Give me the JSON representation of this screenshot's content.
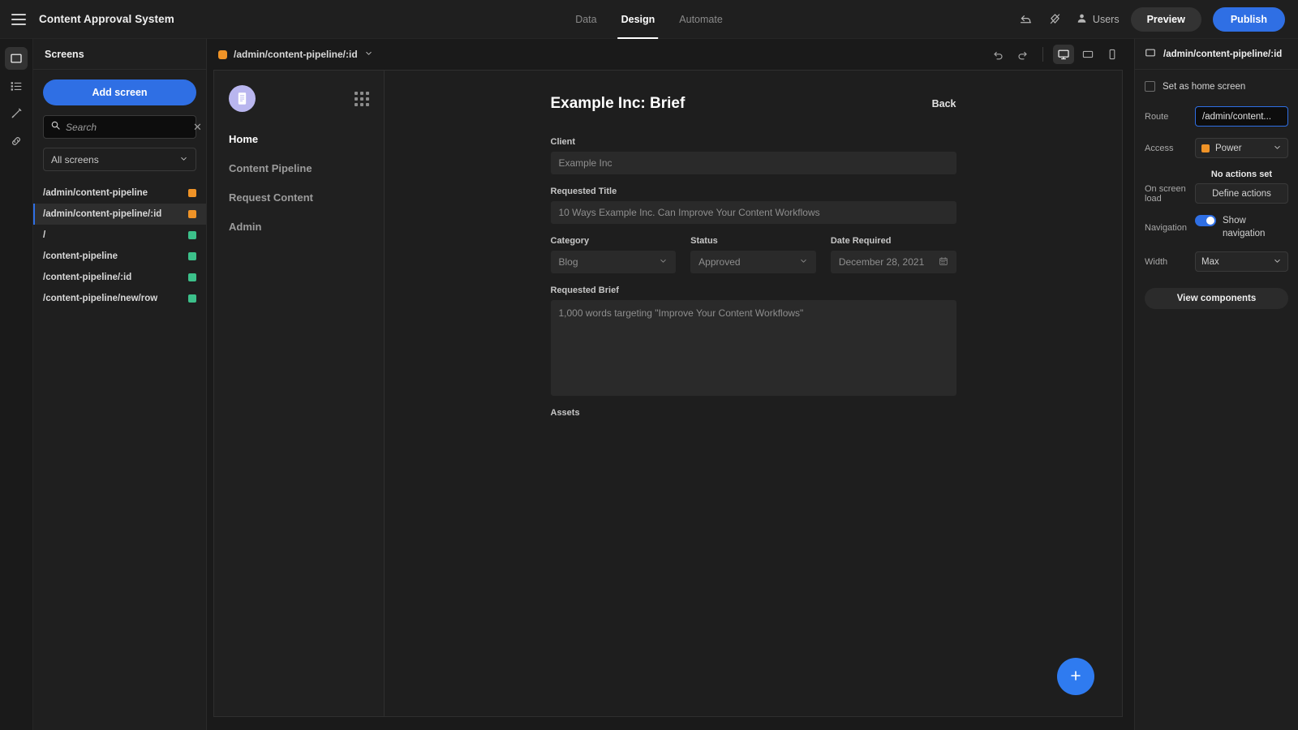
{
  "topbar": {
    "menu_icon": "hamburger-icon",
    "app_title": "Content Approval System",
    "tabs": [
      {
        "label": "Data",
        "active": false
      },
      {
        "label": "Design",
        "active": true
      },
      {
        "label": "Automate",
        "active": false
      }
    ],
    "undo_icon": "undo-icon",
    "revert_icon": "revert-slash-icon",
    "users_icon": "user-icon",
    "users_label": "Users",
    "preview_label": "Preview",
    "publish_label": "Publish",
    "publish_color": "#2f6fe4"
  },
  "rail": {
    "items": [
      {
        "name": "screens-icon",
        "active": true
      },
      {
        "name": "list-icon",
        "active": false
      },
      {
        "name": "brush-icon",
        "active": false
      },
      {
        "name": "link-icon",
        "active": false
      }
    ]
  },
  "screens_panel": {
    "heading": "Screens",
    "add_label": "Add screen",
    "search_placeholder": "Search",
    "search_value": "",
    "search_icon": "search-icon",
    "clear_icon": "close-icon",
    "filter_label": "All screens",
    "items": [
      {
        "route": "/admin/content-pipeline",
        "color": "#ef9327",
        "selected": false
      },
      {
        "route": "/admin/content-pipeline/:id",
        "color": "#ef9327",
        "selected": true
      },
      {
        "route": "/",
        "color": "#3cc08a",
        "selected": false
      },
      {
        "route": "/content-pipeline",
        "color": "#3cc08a",
        "selected": false
      },
      {
        "route": "/content-pipeline/:id",
        "color": "#3cc08a",
        "selected": false
      },
      {
        "route": "/content-pipeline/new/row",
        "color": "#3cc08a",
        "selected": false
      }
    ]
  },
  "canvas_bar": {
    "route_label": "/admin/content-pipeline/:id",
    "route_color": "#ef9327",
    "chevron_icon": "chevron-down-icon",
    "undo_icon": "undo-icon",
    "redo_icon": "redo-icon",
    "viewports": [
      {
        "name": "desktop-icon",
        "active": true
      },
      {
        "name": "tablet-icon",
        "active": false
      },
      {
        "name": "mobile-icon",
        "active": false
      }
    ]
  },
  "preview": {
    "logo_icon": "notepad-logo-icon",
    "grid_icon": "grid-handle-icon",
    "nav_links": [
      {
        "label": "Home",
        "active": true
      },
      {
        "label": "Content Pipeline",
        "active": false
      },
      {
        "label": "Request Content",
        "active": false
      },
      {
        "label": "Admin",
        "active": false
      }
    ],
    "form_title": "Example Inc: Brief",
    "back_label": "Back",
    "fields": {
      "client_label": "Client",
      "client_value": "Example Inc",
      "title_label": "Requested Title",
      "title_value": "10 Ways Example Inc. Can Improve Your Content Workflows",
      "category_label": "Category",
      "category_value": "Blog",
      "status_label": "Status",
      "status_value": "Approved",
      "date_label": "Date Required",
      "date_value": "December 28, 2021",
      "date_icon": "calendar-icon",
      "brief_label": "Requested Brief",
      "brief_value": "1,000 words targeting \"Improve Your Content Workflows\"",
      "assets_label": "Assets"
    },
    "fab_icon": "plus-icon"
  },
  "right_panel": {
    "screen_icon": "screen-icon",
    "heading": "/admin/content-pipeline/:id",
    "home_checkbox_label": "Set as home screen",
    "home_checked": false,
    "route_label": "Route",
    "route_value": "/admin/content...",
    "access_label": "Access",
    "access_value": "Power",
    "access_color": "#ef9327",
    "onload_label": "On screen load",
    "no_actions_text": "No actions set",
    "define_actions_label": "Define actions",
    "navigation_label": "Navigation",
    "show_navigation_label": "Show navigation",
    "show_navigation_on": true,
    "width_label": "Width",
    "width_value": "Max",
    "view_components_label": "View components"
  }
}
